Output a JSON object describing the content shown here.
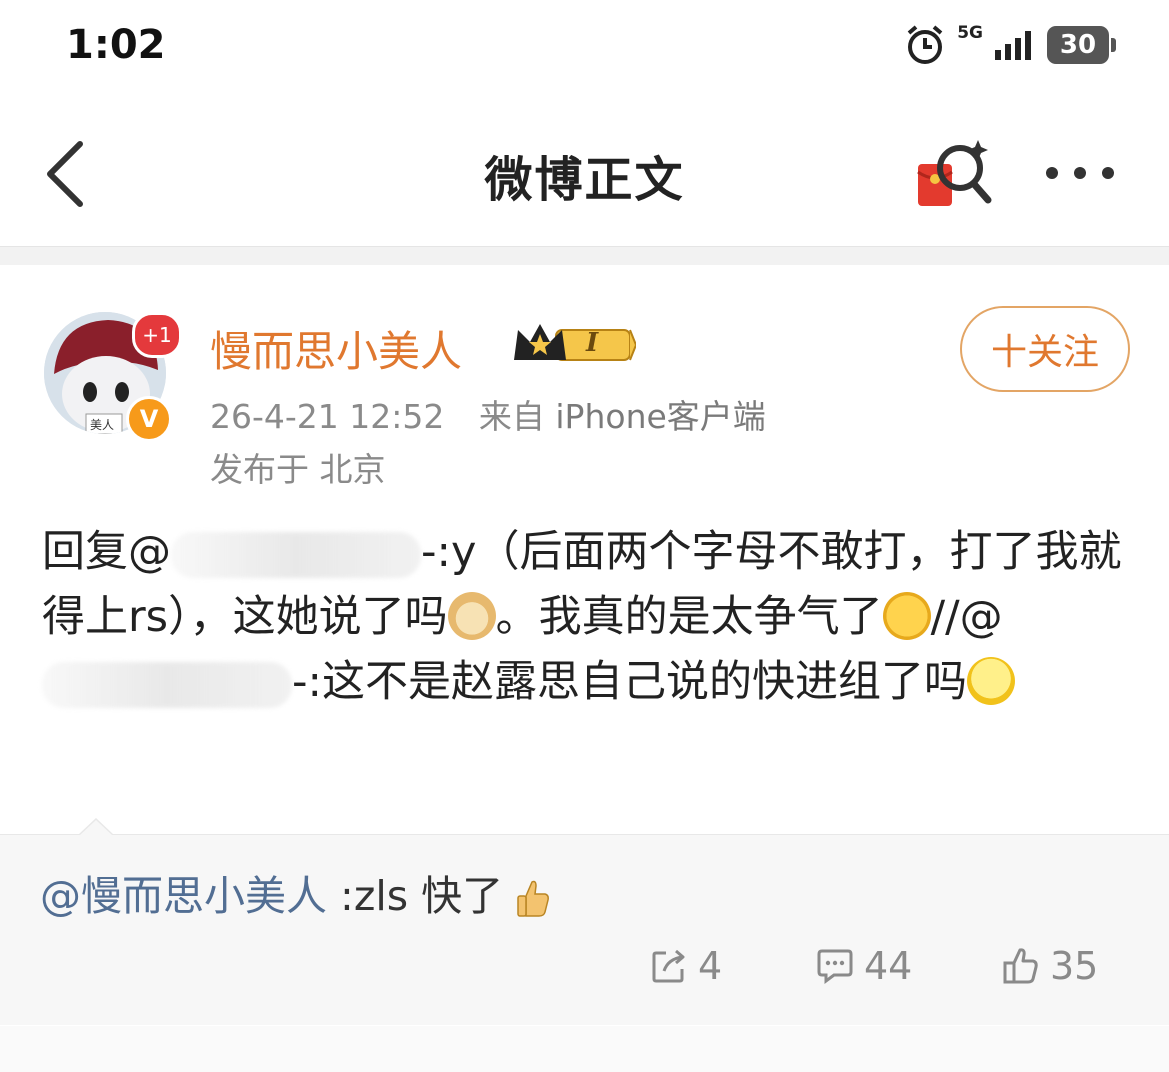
{
  "status_bar": {
    "time": "1:02",
    "network": "5G",
    "battery": "30"
  },
  "nav": {
    "title": "微博正文"
  },
  "post": {
    "avatar_badge": "+1",
    "avatar_tag": "美人",
    "author": "慢而思小美人",
    "verify_mark": "V",
    "rank_label": "I",
    "follow_label": "十关注",
    "date": "26-4-21 12:52",
    "source_prefix": "来自",
    "source_device": "iPhone客户端",
    "location": "发布于 北京",
    "body": {
      "part1": "回复@",
      "part2": "-:y（后面两个字母不敢打，打了我就得上rs），这她说了吗",
      "part3": "。我真的是太争气了",
      "part4": "//@",
      "part5": "-:这不是赵露思自己说的快进组了吗"
    }
  },
  "quote": {
    "mention": "@慢而思小美人",
    "text": " :zls 快了"
  },
  "actions": {
    "repost_count": "4",
    "comment_count": "44",
    "like_count": "35"
  },
  "colors": {
    "accent": "#e0782f",
    "mention": "#526e93",
    "muted": "#8a8a8a"
  }
}
